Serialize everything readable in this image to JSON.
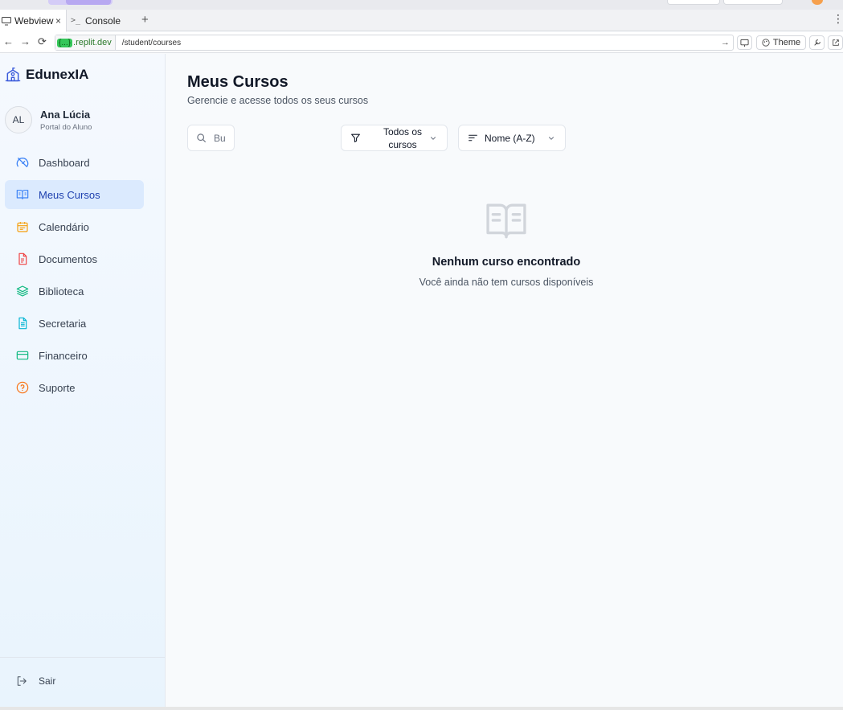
{
  "browser": {
    "tabs": [
      {
        "label": "Webview",
        "close": "×"
      },
      {
        "label": "Console",
        "prompt": ">_"
      }
    ],
    "add_tab": "+",
    "menu": "⋮",
    "nav": {
      "back": "←",
      "forward": "→",
      "reload": "⟳"
    },
    "url": {
      "domain_tag": "{...}",
      "domain": ".replit.dev",
      "path": "/student/courses",
      "go": "→"
    },
    "theme_label": "Theme"
  },
  "sidebar": {
    "brand": "EdunexIA",
    "user": {
      "initials": "AL",
      "name": "Ana Lúcia",
      "role": "Portal do Aluno"
    },
    "items": [
      {
        "label": "Dashboard",
        "icon": "dashboard-icon",
        "color": "#3b82f6"
      },
      {
        "label": "Meus Cursos",
        "icon": "book-open-icon",
        "color": "#3b82f6",
        "active": true
      },
      {
        "label": "Calendário",
        "icon": "calendar-icon",
        "color": "#f59e0b"
      },
      {
        "label": "Documentos",
        "icon": "document-icon",
        "color": "#ef4444"
      },
      {
        "label": "Biblioteca",
        "icon": "layers-icon",
        "color": "#10b981"
      },
      {
        "label": "Secretaria",
        "icon": "file-text-icon",
        "color": "#06b6d4"
      },
      {
        "label": "Financeiro",
        "icon": "credit-card-icon",
        "color": "#10b981"
      },
      {
        "label": "Suporte",
        "icon": "help-circle-icon",
        "color": "#f97316"
      }
    ],
    "logout": "Sair"
  },
  "main": {
    "title": "Meus Cursos",
    "subtitle": "Gerencie e acesse todos os seus cursos",
    "search_placeholder": "Bu",
    "filter_label": "Todos os cursos",
    "sort_label": "Nome (A-Z)",
    "empty_title": "Nenhum curso encontrado",
    "empty_desc": "Você ainda não tem cursos disponíveis"
  }
}
